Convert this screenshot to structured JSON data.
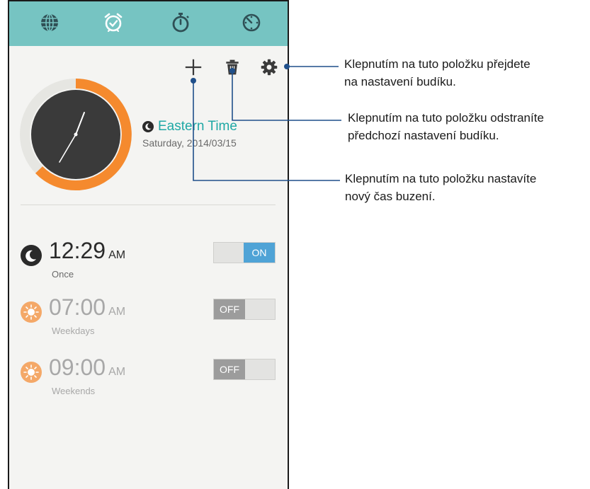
{
  "tabs": [
    {
      "name": "world-clock",
      "icon": "globe-icon"
    },
    {
      "name": "alarm",
      "icon": "alarm-clock-icon"
    },
    {
      "name": "stopwatch",
      "icon": "stopwatch-icon"
    },
    {
      "name": "timer",
      "icon": "timer-icon"
    }
  ],
  "toolbar": {
    "add_icon": "plus-icon",
    "delete_icon": "trash-icon",
    "settings_icon": "gear-icon"
  },
  "clock": {
    "timezone_name": "Eastern Time",
    "date": "Saturday, 2014/03/15"
  },
  "alarms": [
    {
      "time": "12:29",
      "ampm": "AM",
      "repeat": "Once",
      "state": "ON",
      "icon": "moon-icon"
    },
    {
      "time": "07:00",
      "ampm": "AM",
      "repeat": "Weekdays",
      "state": "OFF",
      "icon": "sun-icon"
    },
    {
      "time": "09:00",
      "ampm": "AM",
      "repeat": "Weekends",
      "state": "OFF",
      "icon": "sun-icon"
    }
  ],
  "callouts": {
    "settings": [
      "Klepnutím na tuto položku přejdete",
      "na nastavení budíku."
    ],
    "delete": [
      "Klepnutím na tuto položku odstraníte",
      "předchozí nastavení budíku."
    ],
    "add": [
      "Klepnutím na tuto položku nastavíte",
      "nový čas buzení."
    ]
  },
  "colors": {
    "tabbar": "#76c4c2",
    "accent_teal": "#1fa8a5",
    "ring_orange": "#f58a2e",
    "toggle_on": "#4fa3d6",
    "toggle_off": "#9c9c9c",
    "sun_orange": "#f4a868"
  }
}
